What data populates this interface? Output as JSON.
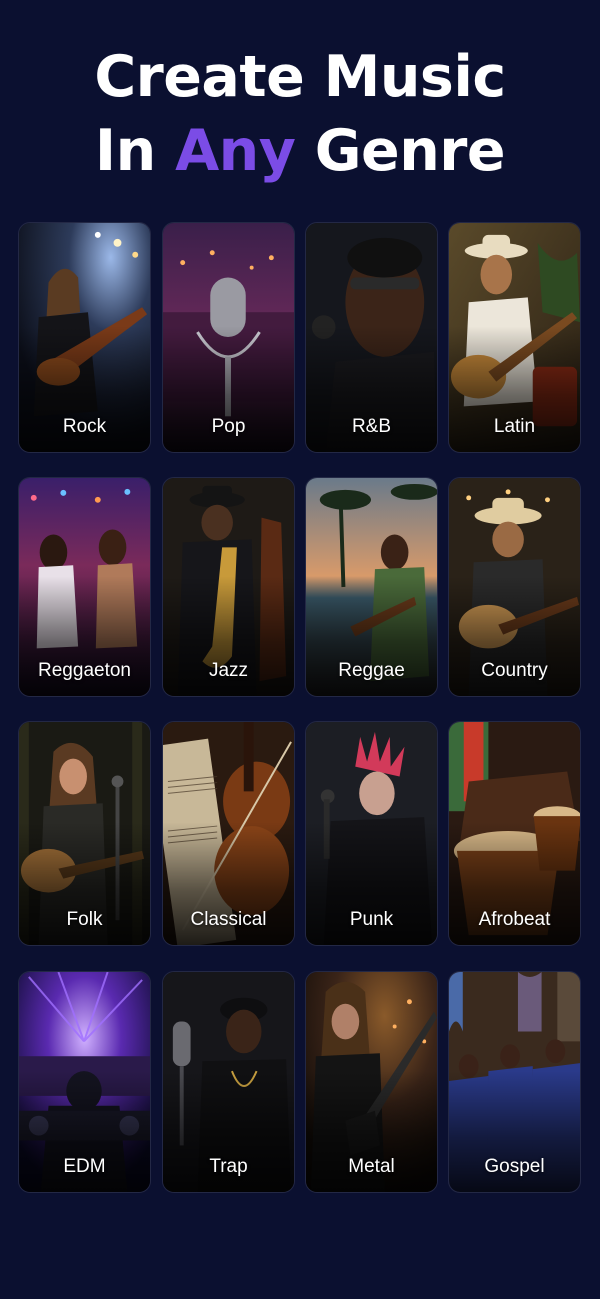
{
  "headline": {
    "line1": "Create Music",
    "line2_before": "In ",
    "line2_accent": "Any",
    "line2_after": " Genre"
  },
  "colors": {
    "background": "#0b1030",
    "accent": "#7b4ce6",
    "text": "#ffffff"
  },
  "genres": [
    {
      "label": "Rock",
      "icon": "rock-guitarist-photo"
    },
    {
      "label": "Pop",
      "icon": "pop-microphone-photo"
    },
    {
      "label": "R&B",
      "icon": "rnb-singer-photo"
    },
    {
      "label": "Latin",
      "icon": "latin-guitarist-photo"
    },
    {
      "label": "Reggaeton",
      "icon": "reggaeton-dancers-photo"
    },
    {
      "label": "Jazz",
      "icon": "jazz-saxophonist-photo"
    },
    {
      "label": "Reggae",
      "icon": "reggae-beach-guitarist-photo"
    },
    {
      "label": "Country",
      "icon": "country-guitarist-photo"
    },
    {
      "label": "Folk",
      "icon": "folk-singer-photo"
    },
    {
      "label": "Classical",
      "icon": "classical-violin-photo"
    },
    {
      "label": "Punk",
      "icon": "punk-singer-photo"
    },
    {
      "label": "Afrobeat",
      "icon": "afrobeat-drums-photo"
    },
    {
      "label": "EDM",
      "icon": "edm-dj-photo"
    },
    {
      "label": "Trap",
      "icon": "trap-rapper-photo"
    },
    {
      "label": "Metal",
      "icon": "metal-guitarist-photo"
    },
    {
      "label": "Gospel",
      "icon": "gospel-choir-photo"
    }
  ]
}
